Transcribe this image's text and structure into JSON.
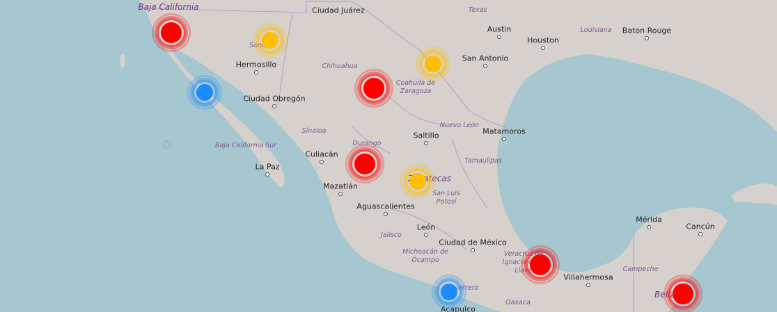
{
  "colors": {
    "sea": "#a6c7cf",
    "land": "#d6d1cc",
    "border": "#b9a6c7",
    "red": "#ff0000",
    "orange": "#ffbf00",
    "blue": "#1a8cff"
  },
  "cities": [
    {
      "id": "ciudad-juarez",
      "name": "Ciudad Juárez"
    },
    {
      "id": "austin",
      "name": "Austin"
    },
    {
      "id": "baton-rouge",
      "name": "Baton Rouge"
    },
    {
      "id": "houston",
      "name": "Houston"
    },
    {
      "id": "san-antonio",
      "name": "San Antonio"
    },
    {
      "id": "hermosillo",
      "name": "Hermosillo"
    },
    {
      "id": "ciudad-obregon",
      "name": "Ciudad Obregón"
    },
    {
      "id": "saltillo",
      "name": "Saltillo"
    },
    {
      "id": "matamoros",
      "name": "Matamoros"
    },
    {
      "id": "culiacan",
      "name": "Culiacán"
    },
    {
      "id": "la-paz",
      "name": "La Paz"
    },
    {
      "id": "mazatlan",
      "name": "Mazatlán"
    },
    {
      "id": "aguascalientes",
      "name": "Aguascalientes"
    },
    {
      "id": "leon",
      "name": "León"
    },
    {
      "id": "ciudad-de-mexico",
      "name": "Ciudad de México"
    },
    {
      "id": "villahermosa",
      "name": "Villahermosa"
    },
    {
      "id": "merida",
      "name": "Mérida"
    },
    {
      "id": "cancun",
      "name": "Cancún"
    },
    {
      "id": "acapulco",
      "name": "Acapulco"
    }
  ],
  "states": [
    {
      "id": "baja-california",
      "name": "Baja California"
    },
    {
      "id": "texas",
      "name": "Texas"
    },
    {
      "id": "louisiana",
      "name": "Louisiana"
    },
    {
      "id": "sonora",
      "name": "Sonora"
    },
    {
      "id": "chihuahua",
      "name": "Chihuahua"
    },
    {
      "id": "coahuila",
      "name": "Coahuila de Zaragoza"
    },
    {
      "id": "nuevo-leon",
      "name": "Nuevo León"
    },
    {
      "id": "sinaloa",
      "name": "Sinaloa"
    },
    {
      "id": "baja-california-sur",
      "name": "Baja California Sur"
    },
    {
      "id": "durango",
      "name": "Durango"
    },
    {
      "id": "tamaulipas",
      "name": "Tamaulipas"
    },
    {
      "id": "zacatecas",
      "name": "Zacatecas"
    },
    {
      "id": "san-luis-potosi",
      "name": "San Luis Potosí"
    },
    {
      "id": "jalisco",
      "name": "Jalisco"
    },
    {
      "id": "michoacan",
      "name": "Michoacán de Ocampo"
    },
    {
      "id": "veracruz",
      "name": "Veracruz de Ignacio de la Llave"
    },
    {
      "id": "campeche",
      "name": "Campeche"
    },
    {
      "id": "guerrero",
      "name": "Guerrero"
    },
    {
      "id": "oaxaca",
      "name": "Oaxaca"
    },
    {
      "id": "belize",
      "name": "Belize"
    }
  ],
  "markers": [
    {
      "id": "marker-baja-california",
      "status": "red"
    },
    {
      "id": "marker-sonora",
      "status": "orange"
    },
    {
      "id": "marker-coahuila-north",
      "status": "orange"
    },
    {
      "id": "marker-chihuahua",
      "status": "red"
    },
    {
      "id": "marker-sinaloa-coast",
      "status": "blue"
    },
    {
      "id": "marker-durango",
      "status": "red"
    },
    {
      "id": "marker-zacatecas",
      "status": "orange"
    },
    {
      "id": "marker-veracruz",
      "status": "red"
    },
    {
      "id": "marker-guerrero",
      "status": "blue"
    },
    {
      "id": "marker-belize",
      "status": "red"
    }
  ]
}
